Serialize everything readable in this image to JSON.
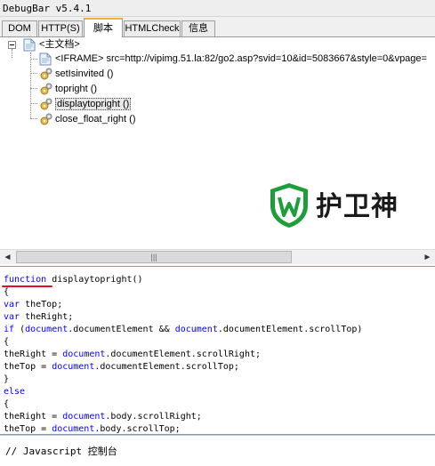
{
  "app": {
    "title": "DebugBar v5.4.1"
  },
  "tabs": [
    {
      "label": "DOM"
    },
    {
      "label": "HTTP(S)"
    },
    {
      "label": "脚本",
      "active": true
    },
    {
      "label": "HTMLCheck"
    },
    {
      "label": "信息"
    }
  ],
  "tree": {
    "root_label": "<主文档>",
    "items": [
      {
        "label": "<IFRAME> src=http://vipimg.51.la:82/go2.asp?svid=10&id=5083667&style=0&vpage=",
        "icon": "document-icon"
      },
      {
        "label": "setIsinvited ()",
        "icon": "gear-icon"
      },
      {
        "label": "topright ()",
        "icon": "gear-icon"
      },
      {
        "label": "displaytopright ()",
        "icon": "gear-icon",
        "selected": true
      },
      {
        "label": "close_float_right ()",
        "icon": "gear-icon"
      }
    ]
  },
  "watermark": {
    "text": "护卫神"
  },
  "scrollbar": {
    "left_arrow": "◄",
    "right_arrow": "►",
    "thumb_grip": "|||"
  },
  "code": {
    "lines": [
      "function displaytopright()",
      "{",
      "var theTop;",
      "var theRight;",
      "if (document.documentElement && document.documentElement.scrollTop)",
      "{",
      "theRight = document.documentElement.scrollRight;",
      "theTop = document.documentElement.scrollTop;",
      "}",
      "else",
      "{",
      "theRight = document.body.scrollRight;",
      "theTop = document.body.scrollTop;"
    ]
  },
  "console": {
    "placeholder": "// Javascript 控制台"
  },
  "colors": {
    "keyword": "#0000ff",
    "underline": "#e0101f",
    "selection_border": "#7f9db9",
    "active_tab_accent": "#f2b234",
    "brand_green": "#1e9e3a"
  }
}
